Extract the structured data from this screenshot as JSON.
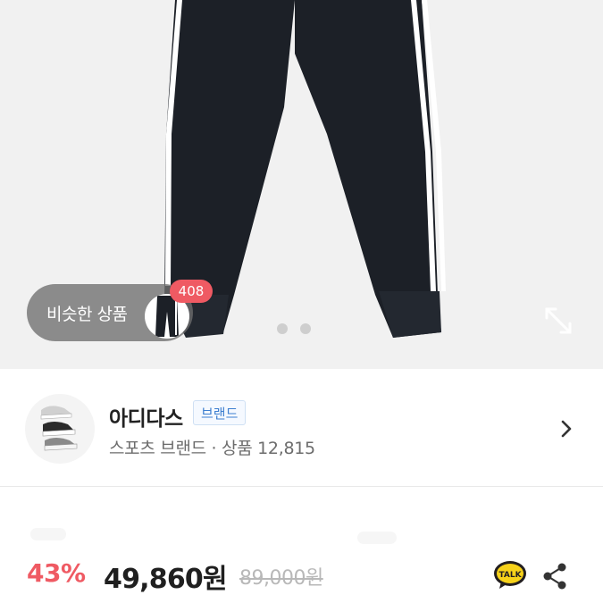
{
  "similar": {
    "label": "비슷한 상품",
    "count": "408"
  },
  "gallery": {
    "slides": 2
  },
  "brand": {
    "name": "아디다스",
    "tag": "브랜드",
    "subtitle": "스포츠 브랜드 · 상품 12,815"
  },
  "price": {
    "discount": "43%",
    "sale": "49,860원",
    "original": "89,000원"
  },
  "share": {
    "talk_label": "TALK"
  },
  "colors": {
    "accent": "#ef5a63",
    "brand_tag": "#3d7fd0"
  }
}
